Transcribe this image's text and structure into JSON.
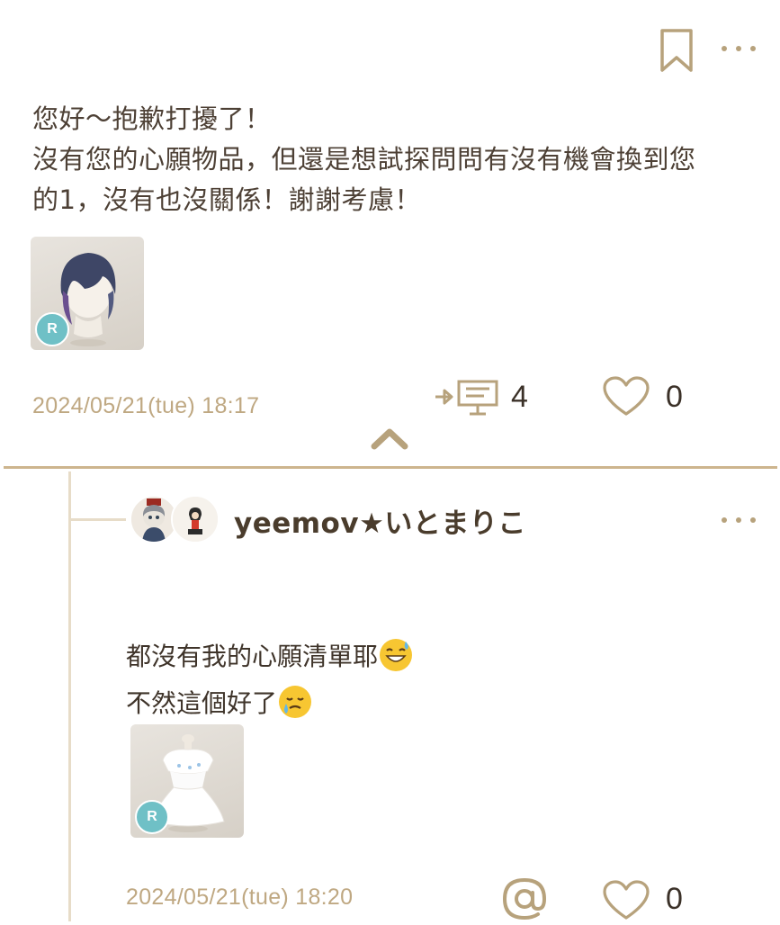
{
  "post": {
    "lines": [
      "您好～抱歉打擾了！",
      "沒有您的心願物品，但還是想試探問問有沒有機會換到您",
      "的1，沒有也沒關係！謝謝考慮！"
    ],
    "item_badge": "R",
    "timestamp": "2024/05/21(tue) 18:17",
    "reply_count": "4",
    "like_count": "0"
  },
  "reply": {
    "username": "yeemov★いとまりこ",
    "lines": [
      "都沒有我的心願清單耶",
      "不然這個好了"
    ],
    "item_badge": "R",
    "timestamp": "2024/05/21(tue) 18:20",
    "like_count": "0"
  },
  "colors": {
    "accent": "#bfa882",
    "divider": "#cdb58e",
    "badge": "#6fc0c6",
    "text": "#4d4035"
  },
  "icons": [
    "bookmark-icon",
    "more-icon",
    "reply-thread-icon",
    "heart-icon",
    "collapse-chevron-icon",
    "mention-icon",
    "grinning-sweat-emoji",
    "crying-smile-emoji"
  ]
}
